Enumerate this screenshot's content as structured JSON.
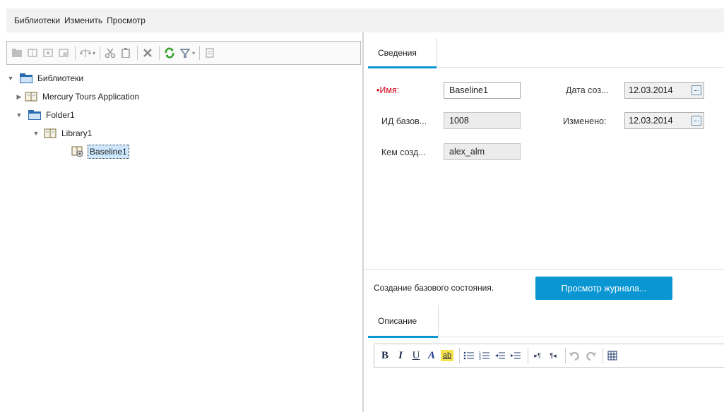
{
  "menu": {
    "items": [
      "Библиотеки",
      "Изменить",
      "Просмотр"
    ]
  },
  "tree": {
    "root": "Библиотеки",
    "mercury": "Mercury Tours Application",
    "folder": "Folder1",
    "library": "Library1",
    "baseline": "Baseline1"
  },
  "details": {
    "tab": "Сведения",
    "name_label": "Имя:",
    "name_required_mark": "•",
    "name_value": "Baseline1",
    "id_label": "ИД базов...",
    "id_value": "1008",
    "created_by_label": "Кем созд...",
    "created_by_value": "alex_alm",
    "created_date_label": "Дата соз...",
    "created_date_value": "12.03.2014",
    "modified_label": "Изменено:",
    "modified_value": "12.03.2014"
  },
  "status": {
    "text": "Создание базового состояния.",
    "history_button": "Просмотр журнала..."
  },
  "description": {
    "tab": "Описание",
    "toolbar": {
      "bold": "B",
      "italic": "I",
      "underline": "U",
      "font_color": "A",
      "highlight": "ab"
    }
  },
  "colors": {
    "accent": "#0a96d2",
    "required": "#d0021b",
    "selection": "#cde8ff"
  }
}
